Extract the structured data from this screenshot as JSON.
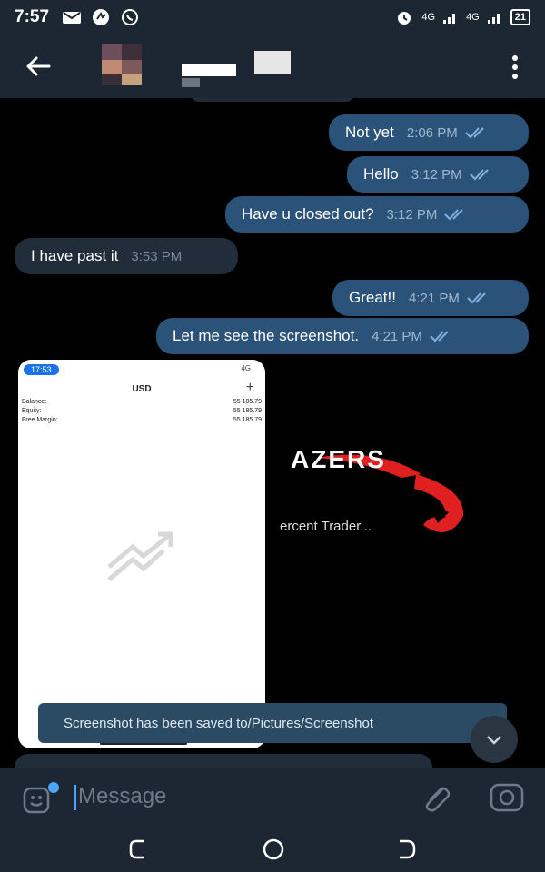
{
  "status_bar": {
    "time": "7:57",
    "network_label": "4G",
    "network_label_2": "4G",
    "battery": "21"
  },
  "header": {
    "back_icon": "arrow-left-icon",
    "menu_icon": "more-vertical-icon"
  },
  "messages": [
    {
      "direction": "outgoing",
      "text": "Not yet",
      "time": "2:06 PM"
    },
    {
      "direction": "outgoing",
      "text": "Hello",
      "time": "3:12 PM"
    },
    {
      "direction": "outgoing",
      "text": "Have u closed out?",
      "time": "3:12 PM"
    },
    {
      "direction": "incoming",
      "text": "I have past it",
      "time": "3:53 PM"
    },
    {
      "direction": "outgoing",
      "text": "Great!!",
      "time": "4:21 PM"
    },
    {
      "direction": "outgoing",
      "text": "Let me see the screenshot.",
      "time": "4:21 PM"
    }
  ],
  "shared_screenshot": {
    "time_badge": "17:53",
    "signal": "4G",
    "title": "USD",
    "rows": [
      {
        "label": "Balance:",
        "value": "55 185.79"
      },
      {
        "label": "Equity:",
        "value": "55 185.79"
      },
      {
        "label": "Free Margin:",
        "value": "55 185.79"
      }
    ]
  },
  "background_brand": {
    "name": "AZERS",
    "tagline": "ercent Trader..."
  },
  "toast": {
    "text": "Screenshot has been saved to/Pictures/Screenshot"
  },
  "composer": {
    "placeholder": "Message"
  },
  "colors": {
    "header_bg": "#1d2733",
    "outgoing_bubble": "#2b5278",
    "incoming_bubble": "#212d3b",
    "accent": "#4ea4f6"
  }
}
